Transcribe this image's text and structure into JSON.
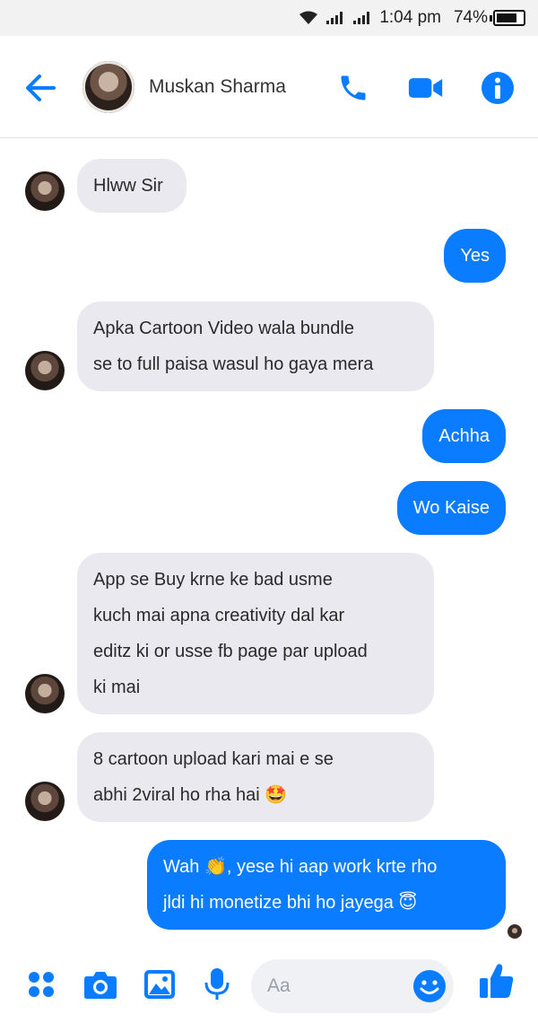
{
  "status_bar": {
    "time": "1:04 pm",
    "battery": "74%"
  },
  "header": {
    "contact_name": "Muskan Sharma"
  },
  "messages": [
    {
      "side": "in",
      "lines": [
        "Hlww Sir"
      ]
    },
    {
      "side": "out",
      "lines": [
        "Yes"
      ]
    },
    {
      "side": "in",
      "lines": [
        "Apka Cartoon Video wala bundle",
        "se to full paisa wasul ho gaya mera"
      ]
    },
    {
      "side": "out",
      "lines": [
        "Achha"
      ]
    },
    {
      "side": "out",
      "lines": [
        "Wo Kaise"
      ]
    },
    {
      "side": "in",
      "lines": [
        "App se Buy krne ke bad usme",
        "kuch mai apna creativity dal kar",
        "editz ki or usse fb page par upload",
        "ki mai"
      ]
    },
    {
      "side": "in",
      "lines": [
        "8 cartoon upload kari mai e se",
        "abhi 2viral ho rha hai 🤩"
      ]
    },
    {
      "side": "out",
      "lines": [
        "Wah 👏, yese hi aap work krte rho",
        "jldi hi monetize bhi ho jayega 😇"
      ]
    }
  ],
  "composer": {
    "placeholder": "Aa"
  },
  "colors": {
    "accent": "#0a7cff",
    "incoming_bubble": "#e9e9ef",
    "icon_blue": "#0a7cff"
  },
  "icons": [
    "back-arrow",
    "phone",
    "video-camera",
    "info",
    "menu-dots",
    "camera",
    "gallery",
    "microphone",
    "emoji",
    "thumbs-up"
  ]
}
